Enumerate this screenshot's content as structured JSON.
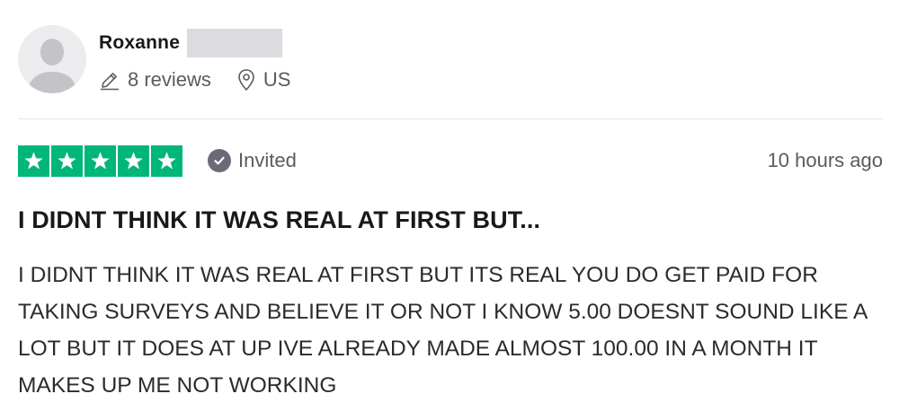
{
  "reviewer": {
    "name": "Roxanne",
    "reviews_count": "8 reviews",
    "country": "US"
  },
  "review": {
    "rating": 5,
    "max_rating": 5,
    "badge": "Invited",
    "date": "10 hours ago",
    "title": "I DIDNT THINK IT WAS REAL AT FIRST BUT...",
    "body": "I DIDNT THINK IT WAS REAL AT FIRST BUT ITS REAL YOU DO GET PAID FOR TAKING SURVEYS AND BELIEVE IT OR NOT I KNOW 5.00 DOESNT SOUND LIKE A LOT BUT IT DOES AT UP IVE ALREADY MADE ALMOST 100.00 IN A MONTH IT MAKES UP ME NOT WORKING"
  },
  "colors": {
    "star_green": "#00b67a",
    "badge_gray": "#6b6b78",
    "text_dark": "#191919",
    "text_muted": "#5a5a62"
  },
  "icons": {
    "avatar": "person-silhouette-icon",
    "reviews": "pencil-icon",
    "location": "location-pin-icon",
    "star": "star-icon",
    "invited": "checkmark-icon"
  }
}
